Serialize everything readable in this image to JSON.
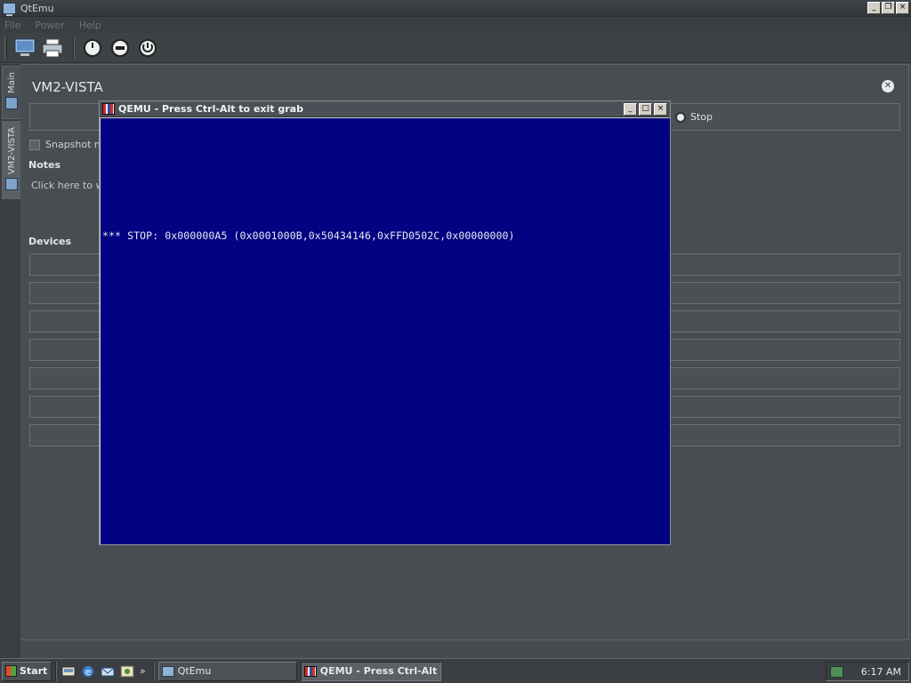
{
  "window": {
    "title": "QtEmu"
  },
  "window_buttons": {
    "minimize": "_",
    "maximize": "❐",
    "close": "×"
  },
  "menu": {
    "items": [
      "File",
      "Power",
      "Help"
    ]
  },
  "toolbar": {
    "icons": [
      "new-machine-icon",
      "printer-icon",
      "power-icon",
      "pause-icon",
      "restart-icon"
    ]
  },
  "tabs": {
    "main": "Main",
    "vm": "VM2-VISTA"
  },
  "vm": {
    "name": "VM2-VISTA",
    "stop_label": "Stop",
    "snapshot_label": "Snapshot mo",
    "notes_title": "Notes",
    "notes_hint": "Click here to wr",
    "devices_title": "Devices"
  },
  "qemu": {
    "title": "QEMU - Press Ctrl-Alt to exit grab",
    "stop_message": "*** STOP: 0x000000A5 (0x0001000B,0x50434146,0xFFD0502C,0x00000000)"
  },
  "taskbar": {
    "start_label": "Start",
    "quicklaunch_more": "»",
    "tasks": [
      {
        "label": "QtEmu",
        "active": false
      },
      {
        "label": "QEMU - Press Ctrl-Alt t...",
        "active": true
      }
    ],
    "clock": "6:17 AM"
  },
  "colors": {
    "bsod": "#020382",
    "chrome": "#464b4f"
  }
}
